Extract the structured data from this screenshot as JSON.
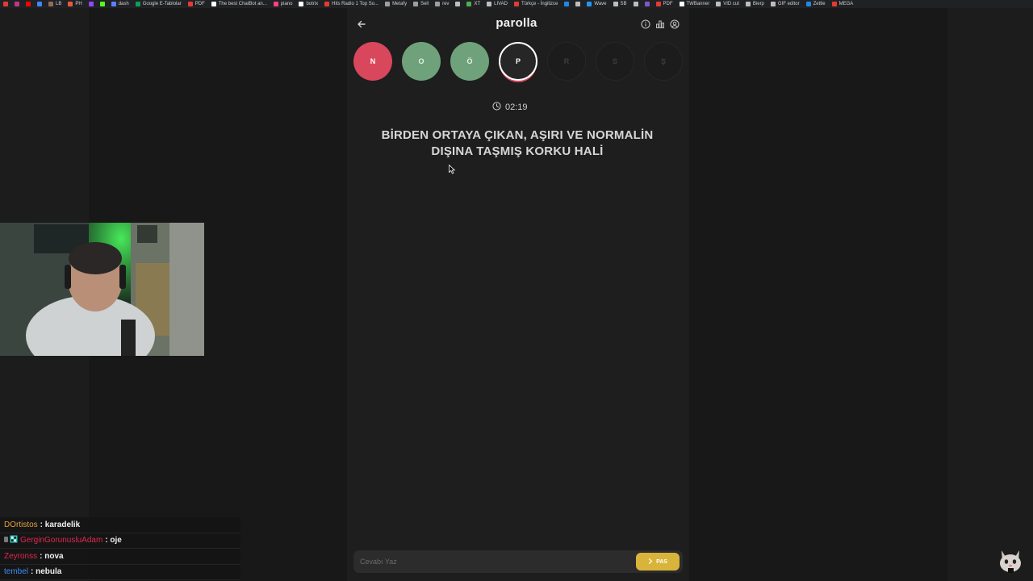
{
  "bookmarks": [
    {
      "label": "",
      "color": "#e53935"
    },
    {
      "label": "",
      "color": "#c13584"
    },
    {
      "label": "",
      "color": "#ff0000"
    },
    {
      "label": "",
      "color": "#4285f4"
    },
    {
      "label": "LB",
      "color": "#8e6e53"
    },
    {
      "label": "PH",
      "color": "#e8593c"
    },
    {
      "label": "",
      "color": "#9146ff"
    },
    {
      "label": "",
      "color": "#53fc18"
    },
    {
      "label": "dash",
      "color": "#5b7fff"
    },
    {
      "label": "Google E-Tablolar",
      "color": "#0f9d58"
    },
    {
      "label": "PDF",
      "color": "#e53935"
    },
    {
      "label": "The best ChatBot an...",
      "color": "#ffffff"
    },
    {
      "label": "piano",
      "color": "#ff4081"
    },
    {
      "label": "botrix",
      "color": "#ffffff"
    },
    {
      "label": "Hits Radio 1 Top So...",
      "color": "#e53935"
    },
    {
      "label": "Metafy",
      "color": "#9e9e9e"
    },
    {
      "label": "Sell",
      "color": "#9e9e9e"
    },
    {
      "label": "rev",
      "color": "#9e9e9e"
    },
    {
      "label": "",
      "color": "#bdbdbd"
    },
    {
      "label": "XT",
      "color": "#4caf50"
    },
    {
      "label": "LIVAD",
      "color": "#bdbdbd"
    },
    {
      "label": "Türkçe - İngilizce",
      "color": "#e53935"
    },
    {
      "label": "",
      "color": "#1e88e5"
    },
    {
      "label": "",
      "color": "#bdbdbd"
    },
    {
      "label": "Wave",
      "color": "#2196f3"
    },
    {
      "label": "SB",
      "color": "#bdbdbd"
    },
    {
      "label": "",
      "color": "#bdbdbd"
    },
    {
      "label": "",
      "color": "#7e57c2"
    },
    {
      "label": "PDF",
      "color": "#e53935"
    },
    {
      "label": "TWBanner",
      "color": "#ffffff"
    },
    {
      "label": "VID cut",
      "color": "#bdbdbd"
    },
    {
      "label": "Bierp",
      "color": "#bdbdbd"
    },
    {
      "label": "GIF editor",
      "color": "#bdbdbd"
    },
    {
      "label": "Zettle",
      "color": "#1e88e5"
    },
    {
      "label": "MEGA",
      "color": "#e53935"
    }
  ],
  "app": {
    "logo": "parolla",
    "letters": [
      {
        "char": "N",
        "state": "wrong"
      },
      {
        "char": "O",
        "state": "correct"
      },
      {
        "char": "Ö",
        "state": "correct"
      },
      {
        "char": "P",
        "state": "current"
      },
      {
        "char": "R",
        "state": "pending"
      },
      {
        "char": "S",
        "state": "pending"
      },
      {
        "char": "Ş",
        "state": "pending"
      }
    ],
    "timer": "02:19",
    "question": "BİRDEN ORTAYA ÇIKAN, AŞIRI VE NORMALİN DIŞINA TAŞMIŞ KORKU HALİ",
    "answer_placeholder": "Cevabı Yaz",
    "pass_label": "PAS"
  },
  "chat": [
    {
      "user": "DOrtistos",
      "color": "#e0a341",
      "message": "karadelik",
      "badges": []
    },
    {
      "user": "GerginGorunusluAdam",
      "color": "#e0284f",
      "message": "oje",
      "badges": [
        "#7a7a7a",
        "#2ec4b6"
      ]
    },
    {
      "user": "Zeyronss",
      "color": "#e0284f",
      "message": "nova",
      "badges": []
    },
    {
      "user": "tembel",
      "color": "#3a8df5",
      "message": "nebula",
      "badges": []
    }
  ],
  "colors": {
    "wrong": "#d9475c",
    "correct": "#6fa27b",
    "pass": "#d8b43a"
  }
}
